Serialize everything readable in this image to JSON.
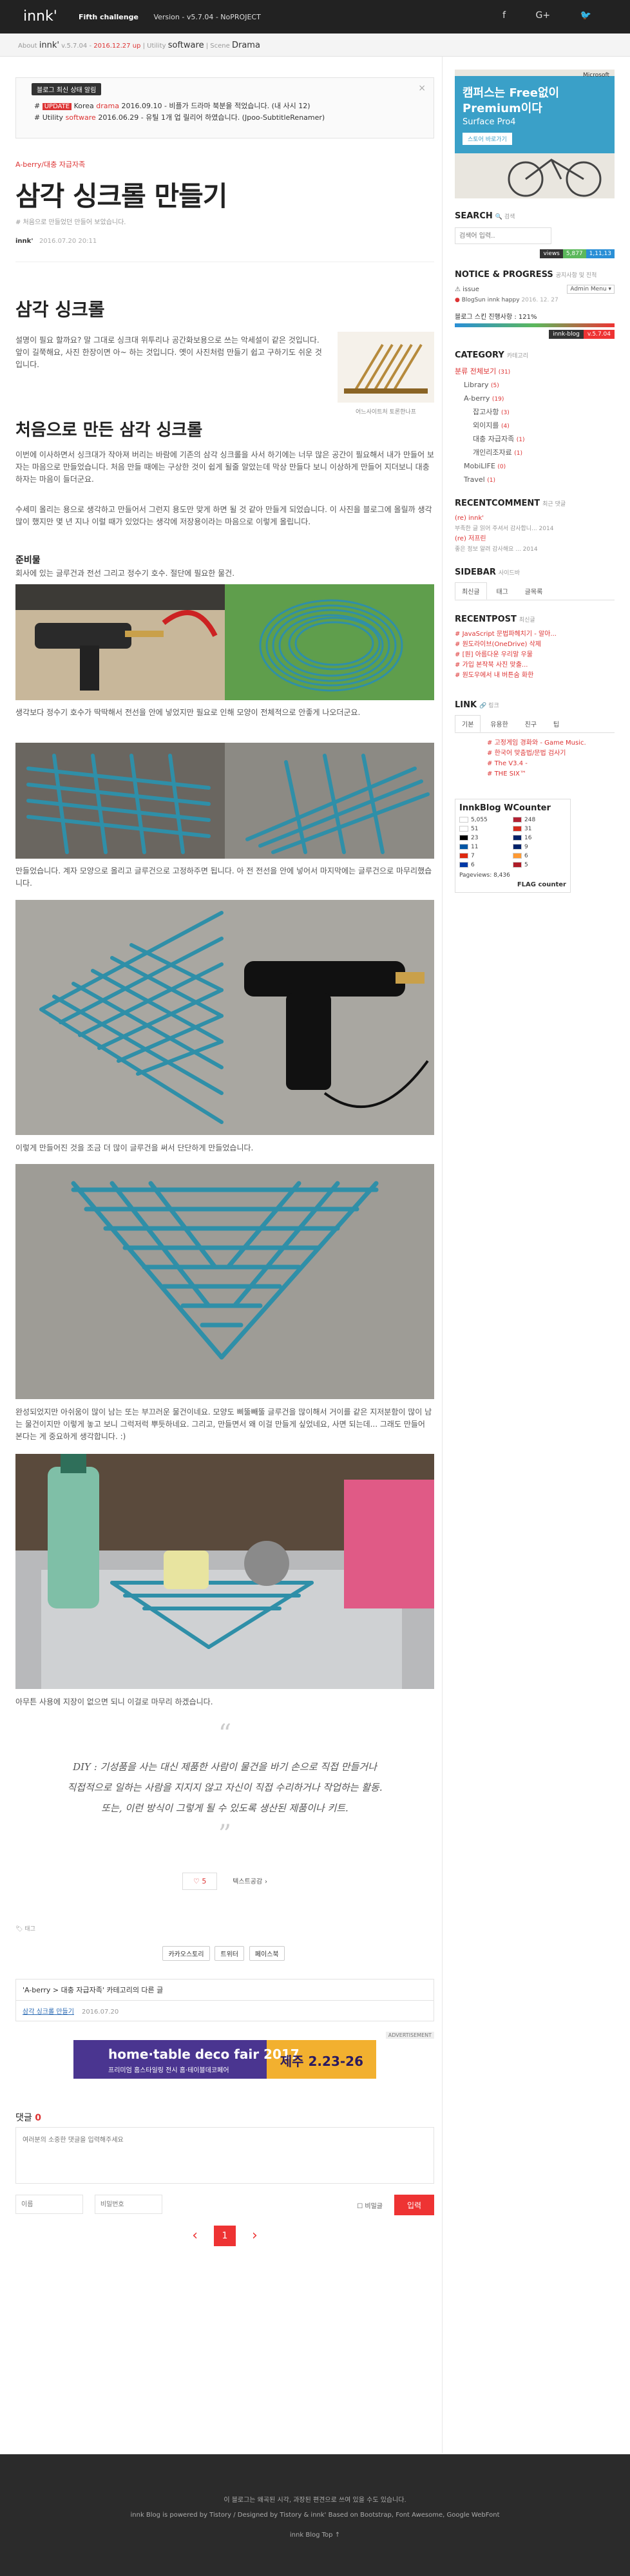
{
  "topbar": {
    "brand": "innk'",
    "nav": [
      "Fifth challenge",
      "Version - v5.7.04 - NoPROJECT"
    ],
    "icons": [
      "facebook-icon",
      "google-plus-icon",
      "twitter-icon"
    ]
  },
  "subbar": {
    "prefix": "About",
    "brand": "innk'",
    "version": "v.5.7.04 -",
    "date": "2016.12.27 up",
    "sep1": "| Utility",
    "software": "software",
    "sep2": "| Scene",
    "drama": "Drama"
  },
  "notice": {
    "tag": "블로그 최신 상태 알림",
    "items": [
      {
        "mark": "#",
        "badge": "UPDATE",
        "text1": " Korea ",
        "hl": "drama",
        "text2": " 2016.09.10 - 비플가 드라마 북분을 적었습니다. (내 사시 12)"
      },
      {
        "mark": "#",
        "badge": "",
        "text1": " Utility ",
        "hl": "software",
        "text2": " 2016.06.29 - 유틸 1개 업 릴리어 하였습니다. (Jpoo-SubtitleRenamer)"
      }
    ]
  },
  "post": {
    "category": "A-berry/대충 자급자족",
    "title": "삼각 싱크롤 만들기",
    "subtitle": "# 처음으로 만들었던 만들어 보았습니다.",
    "author": "innk'",
    "date": "2016.07.20 20:11",
    "h_main": "삼각 싱크롤",
    "p1": "설명이 필요 할까요? 말 그대로 싱크대 위투리나 공간화보용으로 쓰는 악세설이 같은 것입니다. 앞이 길쭉해요, 사진 한장이면 아~ 하는 것입니다. 옛이 사진처럼 만들기 쉽고 구하기도 쉬운 것입니다.",
    "thumb_caption": "어느사이트처 토론한나프",
    "h_first": "처음으로 만든 삼각 싱크롤",
    "p2": "이번에 이사하면서 싱크대가 작아져 버리는 바람에 기존의 삼각 싱크롤을 사서 하기에는 너무 많은 공간이 필요해서 내가 만들어 보자는 마음으로 만들었습니다. 처음 만들 때에는 구상한 것이 쉽게 될줄 알았는데 막상 만들다 보니 이상하게 만들어 지더보니 대충하자는 마음이 들더군요.",
    "p3": "수세미 올리는 용으로 생각하고 만들어서 그런지 용도만 맞게 하면 될 것 같아 만들게 되었습니다. 이 사진을 블로그에 올릴까 생각 많이 했지만 몇 년 지나 이럴 때가 있었다는 생각에 저장용이라는 마음으로 이렇게 올립니다.",
    "h_prep": "준비물",
    "p_prep": "회사에 있는 글루건과 전선 그리고 정수기 호수. 절단에 필요한 물건.",
    "p4": "생각보다 정수기 호수가 딱딱해서 전선을 안에 넣었지만 필요로 인해 모양이 전체적으로 안좋게 나오더군요.",
    "p5": "만들었습니다. 계자 모양으로 올리고 글루건으로 고정하주면 됩니다. 아 전 전선을 안에 넣어서 마지막에는 글루건으로 마무리했습니다.",
    "p6": "이렇게 만들어진 것을 조금 더 많이 글루건을 써서 단단하게 만들었습니다.",
    "p7": "완성되었지만 아쉬움이 많이 남는 또는 부끄러운 물건이네요. 모양도 삐뚤빼뚤 글루건을 많이해서 거이를 같은 지저분함이 많이 남는 물건이지만 이렇게 놓고 보니 그럭저럭 뿌듯하네요. 그리고, 만들면서 왜 이걸 만들게 싶었네요, 사면 되는데... 그래도 만들어 본다는 게 중요하게 생각합니다. :)",
    "p8": "아무튼 사용에 지장이 없으면 되니 이걸로 마무리 하겠습니다.",
    "quote": [
      "DIY : 기성품을 사는 대신 제품한 사람이 물건을 바기 손으로 직접 만들거나",
      "직접적으로 일하는 사람을 지지지 않고 자신이 직접 수리하거나 작업하는 활동.",
      "또는, 이런 방식이 그렇게 될 수 있도록 생산된 제품이나 키트."
    ],
    "like_count": "5",
    "tag_label": "텍스트공감",
    "tag_line": "태그",
    "share": [
      "카카오스토리",
      "트위터",
      "페이스북"
    ],
    "related_head": "'A-berry > 대충 자급자족' 카테고리의 다른 글",
    "related_title": "삼각 싱크롤 만들기",
    "related_date": "2016.07.20",
    "ad_label": "ADVERTISEMENT",
    "ad_title": "home·table deco fair 2017",
    "ad_sub": "프리미엄 홈스타일링 전시 홈·테이블데코페어",
    "ad_right": "제주 2.23-26"
  },
  "comments": {
    "title": "댓글",
    "count": "0",
    "placeholder": "여러분의 소중한 댓글을 입력해주세요",
    "name_placeholder": "이름",
    "pw_placeholder": "비밀번호",
    "secret_label": "비밀글",
    "submit": "입력"
  },
  "pager": {
    "prev": "‹",
    "current": "1",
    "next": "›"
  },
  "sidebar": {
    "ad_line1": "캠퍼스는 Free없이",
    "ad_line2": "Premium이다",
    "ad_line3": "Surface Pro4",
    "ad_btn": "스토어 바로가기",
    "ad_brand": "Microsoft",
    "search_title": "SEARCH",
    "search_sub": "검색",
    "search_placeholder": "검색어 입력..",
    "views_label": "views",
    "views_total": "5,877",
    "views_today": "1,11,13",
    "notice_title": "NOTICE & PROGRESS",
    "notice_sub": "공지사항 및 진척",
    "issue_label": "issue",
    "issue_select": "Admin Menu",
    "issue_item": "BlogSun innk happy",
    "issue_date": "2016. 12. 27",
    "progress_label": "블로그 스킨 진행사항 : 121%",
    "progress_value": 100,
    "progress_badge": "innk-blog",
    "progress_ver": "v.5.7.04",
    "category_title": "CATEGORY",
    "category_sub": "카테고리",
    "categories": [
      {
        "name": "분류 전체보기",
        "count": "(31)",
        "level": 0
      },
      {
        "name": "Library",
        "count": "(5)",
        "level": 1
      },
      {
        "name": "A-berry",
        "count": "(19)",
        "level": 1
      },
      {
        "name": "잡고사항",
        "count": "(3)",
        "level": 2
      },
      {
        "name": "외이지를",
        "count": "(4)",
        "level": 2
      },
      {
        "name": "대충 자급자족",
        "count": "(1)",
        "level": 2
      },
      {
        "name": "개인리조자료",
        "count": "(1)",
        "level": 2
      },
      {
        "name": "MobiLIFE",
        "count": "(0)",
        "level": 1
      },
      {
        "name": "Travel",
        "count": "(1)",
        "level": 1
      }
    ],
    "recentcomment_title": "RECENTCOMMENT",
    "recentcomment_sub": "최근 댓글",
    "recent_comments": [
      {
        "who": "(re) innk'",
        "text": "부족한 글 읽어 주셔서 감사합니... 2014"
      },
      {
        "who": "(re) 저프린",
        "text": "좋은 정보 알려 감사해요 ... 2014"
      }
    ],
    "sidebar_title": "SIDEBAR",
    "sidebar_sub": "사이드바",
    "sidebar_tabs": [
      "최신글",
      "태그",
      "글목록"
    ],
    "recentpost_title": "RECENTPOST",
    "recentpost_sub": "최신글",
    "recent_posts": [
      "JavaScript 문법파헤치기 - 알아...",
      "원도라이브(OneDrive) 삭제",
      "[원] 아름다운 우리말 우물",
      "가입 본작북 사진 맞출...",
      "원도우에서 내 버튼숨 화한"
    ],
    "link_title": "LINK",
    "link_sub": "링크",
    "link_tabs": [
      "기본",
      "유용한",
      "친구",
      "팁"
    ],
    "links": [
      "고정게임 경화와 - Game Music.",
      "한국어 맞춤법/문법 검사기",
      "The V3.4 -",
      "THE SIX™"
    ],
    "counter_title": "InnkBlog WCounter",
    "counter_flags": [
      {
        "flag": "KR",
        "count": "5,055"
      },
      {
        "flag": "US",
        "count": "248"
      },
      {
        "flag": "JP",
        "count": "51"
      },
      {
        "flag": "CA",
        "count": "31"
      },
      {
        "flag": "DE",
        "count": "23"
      },
      {
        "flag": "GB",
        "count": "16"
      },
      {
        "flag": "FR",
        "count": "11"
      },
      {
        "flag": "AU",
        "count": "9"
      },
      {
        "flag": "CN",
        "count": "7"
      },
      {
        "flag": "IN",
        "count": "6"
      },
      {
        "flag": "RU",
        "count": "6"
      },
      {
        "flag": "NL",
        "count": "5"
      }
    ],
    "pageviews": "Pageviews: 8,436",
    "flag_counter": "FLAG counter"
  },
  "footer": {
    "line1": "이 블로그는 왜곡된 시각, 과장된 편견으로 쓰여 있을 수도 있습니다.",
    "line2": "innk Blog is powered by Tistory / Designed by Tistory & innk'  Based on Bootstrap, Font Awesome, Google WebFont",
    "line3": "innk Blog Top"
  },
  "colors": {
    "accent": "#e33333",
    "dark": "#222222",
    "cable_blue": "#2f8fa8"
  }
}
